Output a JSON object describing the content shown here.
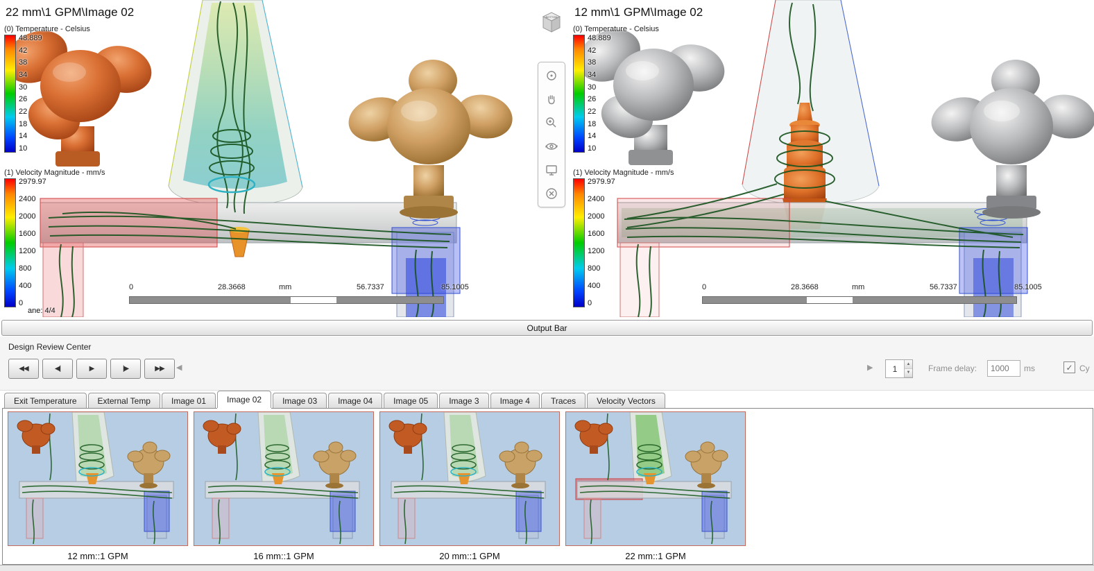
{
  "viewports": [
    {
      "title": "22 mm\\1 GPM\\Image 02",
      "temp_legend": {
        "title": "(0) Temperature - Celsius",
        "ticks": [
          "48.889",
          "42",
          "38",
          "34",
          "30",
          "26",
          "22",
          "18",
          "14",
          "10"
        ]
      },
      "vel_legend": {
        "title": "(1) Velocity Magnitude - mm/s",
        "ticks": [
          "2979.97",
          "2400",
          "2000",
          "1600",
          "1200",
          "800",
          "400",
          "0"
        ]
      },
      "plane_label": "ane: 4/4",
      "ruler": {
        "t0": "0",
        "t1": "28.3668",
        "unit": "mm",
        "t2": "56.7337",
        "t3": "85.1005"
      }
    },
    {
      "title": "12 mm\\1 GPM\\Image 02",
      "temp_legend": {
        "title": "(0) Temperature - Celsius",
        "ticks": [
          "48.889",
          "42",
          "38",
          "34",
          "30",
          "26",
          "22",
          "18",
          "14",
          "10"
        ]
      },
      "vel_legend": {
        "title": "(1) Velocity Magnitude - mm/s",
        "ticks": [
          "2979.97",
          "2400",
          "2000",
          "1600",
          "1200",
          "800",
          "400",
          "0"
        ]
      },
      "plane_label": "",
      "ruler": {
        "t0": "0",
        "t1": "28.3668",
        "unit": "mm",
        "t2": "56.7337",
        "t3": "85.1005"
      }
    }
  ],
  "view_cube": {
    "face_label": "BOTTOM"
  },
  "nav_toolbar_icons": [
    "orbit-icon",
    "pan-icon",
    "zoom-icon",
    "rotate-view-icon",
    "appearance-icon",
    "close-icon"
  ],
  "output_bar": {
    "label": "Output Bar"
  },
  "review_center": {
    "title": "Design Review Center",
    "playback": {
      "to_start": "◀◀",
      "step_back": "◀|",
      "play": "▶",
      "step_forward": "|▶",
      "to_end": "▶▶"
    },
    "slider": {
      "left_arrow": "◀",
      "right_arrow": "▶"
    },
    "spinner": {
      "value": "1",
      "up": "▲",
      "down": "▼"
    },
    "frame_delay_label": "Frame delay:",
    "frame_delay_value": "1000",
    "frame_delay_unit": "ms",
    "cycle_label": "Cy",
    "cycle_checked": true
  },
  "tabs": [
    {
      "label": "Exit Temperature",
      "active": false
    },
    {
      "label": "External Temp",
      "active": false
    },
    {
      "label": "Image 01",
      "active": false
    },
    {
      "label": "Image 02",
      "active": true
    },
    {
      "label": "Image 03",
      "active": false
    },
    {
      "label": "Image 04",
      "active": false
    },
    {
      "label": "Image 05",
      "active": false
    },
    {
      "label": "Image 3",
      "active": false
    },
    {
      "label": "Image 4",
      "active": false
    },
    {
      "label": "Traces",
      "active": false
    },
    {
      "label": "Velocity Vectors",
      "active": false
    }
  ],
  "filmstrip": [
    {
      "caption": "12 mm::1 GPM"
    },
    {
      "caption": "16 mm::1 GPM"
    },
    {
      "caption": "20 mm::1 GPM"
    },
    {
      "caption": "22 mm::1 GPM"
    }
  ],
  "colors": {
    "legend_gradient": [
      "#ff0000",
      "#ff8800",
      "#ffee00",
      "#00cc00",
      "#00ccee",
      "#0000c8"
    ],
    "copper_knob": "#d96f33",
    "brass_knob": "#cf9f63",
    "silver_knob": "#b9babc",
    "streamline_green": "#17521d",
    "overlay_red": "#d04040",
    "overlay_blue": "#3050d0",
    "thumbnail_background": "#b7cde3"
  }
}
